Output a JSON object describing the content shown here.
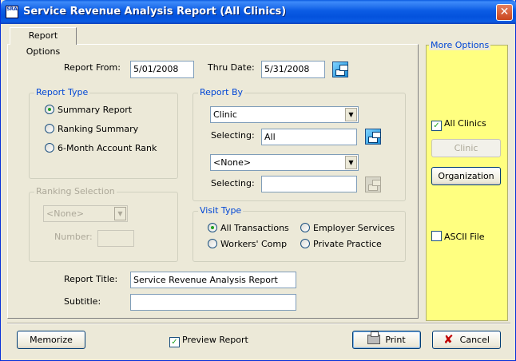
{
  "window": {
    "title": "Service Revenue Analysis Report (All Clinics)",
    "icon_text": "SRA"
  },
  "tabs": [
    {
      "label": "Report Options"
    }
  ],
  "report_from": {
    "label": "Report From:",
    "value": "5/01/2008"
  },
  "thru_date": {
    "label": "Thru Date:",
    "value": "5/31/2008"
  },
  "report_type": {
    "title": "Report Type",
    "options": [
      {
        "label": "Summary Report",
        "selected": true
      },
      {
        "label": "Ranking Summary",
        "selected": false
      },
      {
        "label": "6-Month Account Rank",
        "selected": false
      }
    ]
  },
  "report_by": {
    "title": "Report By",
    "combo1": "Clinic",
    "selecting_label": "Selecting:",
    "selecting1": "All",
    "combo2": "<None>",
    "selecting2": ""
  },
  "ranking_selection": {
    "title": "Ranking Selection",
    "combo": "<None>",
    "number_label": "Number:",
    "number_value": ""
  },
  "visit_type": {
    "title": "Visit Type",
    "options": [
      {
        "label": "All Transactions",
        "selected": true
      },
      {
        "label": "Employer Services",
        "selected": false
      },
      {
        "label": "Workers' Comp",
        "selected": false
      },
      {
        "label": "Private Practice",
        "selected": false
      }
    ]
  },
  "report_title": {
    "label": "Report Title:",
    "value": "Service Revenue Analysis Report"
  },
  "subtitle": {
    "label": "Subtitle:",
    "value": ""
  },
  "more_options": {
    "title": "More Options",
    "all_clinics": {
      "label": "All Clinics",
      "checked": true
    },
    "clinic_button": "Clinic",
    "organization_button": "Organization",
    "ascii_file": {
      "label": "ASCII File",
      "checked": false
    },
    "background": "#ffff80"
  },
  "footer": {
    "memorize": "Memorize",
    "preview": {
      "label": "Preview Report",
      "checked": true
    },
    "print": "Print",
    "cancel": "Cancel"
  },
  "colors": {
    "title_bar": "#0b5ce4",
    "group_title": "#0046d5",
    "dialog_bg": "#ece9d8"
  }
}
